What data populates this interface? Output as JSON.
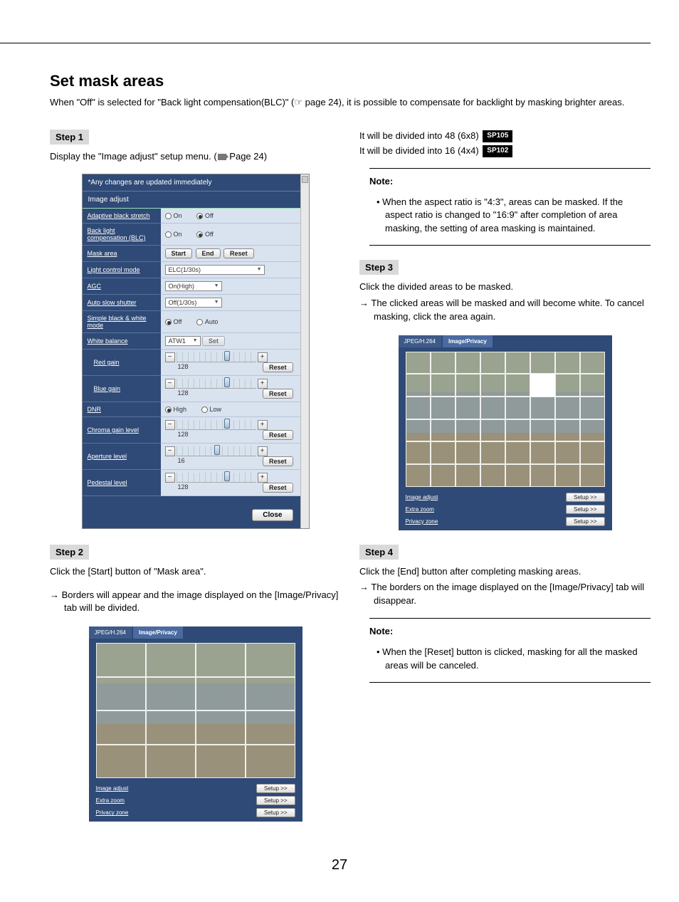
{
  "page_number": "27",
  "title": "Set mask areas",
  "intro": "When \"Off\" is selected for \"Back light compensation(BLC)\" (☞ page 24), it is possible to compensate for backlight by masking brighter areas.",
  "step1": {
    "tag": "Step 1",
    "text": "Display the \"Image adjust\" setup menu. (",
    "ref": " Page 24)"
  },
  "step2": {
    "tag": "Step 2",
    "lead": "Click the [Start] button of \"Mask area\".",
    "arrow": "Borders will appear and the image displayed on the [Image/Privacy] tab will be divided."
  },
  "divided_48": "It will be divided into 48 (6x8)",
  "divided_16": "It will be divided into 16 (4x4)",
  "badge_sp105": "SP105",
  "badge_sp102": "SP102",
  "note1_title": "Note:",
  "note1_body": "When the aspect ratio is \"4:3\", areas can be masked. If the aspect ratio is changed to \"16:9\" after completion of area masking, the setting of area masking is maintained.",
  "step3": {
    "tag": "Step 3",
    "lead": "Click the divided areas to be masked.",
    "arrow": "The clicked areas will be masked and will become white. To cancel masking, click the area again."
  },
  "step4": {
    "tag": "Step 4",
    "lead": "Click the [End] button after completing masking areas.",
    "arrow": "The borders on the image displayed on the [Image/Privacy] tab will disappear."
  },
  "note2_title": "Note:",
  "note2_body": "When the [Reset] button is clicked, masking for all the masked areas will be canceled.",
  "ia": {
    "head": "*Any changes are updated immediately",
    "sub": "Image adjust",
    "rows": {
      "abs": "Adaptive black stretch",
      "blc": "Back light compensation (BLC)",
      "mask": "Mask area",
      "lcm": "Light control mode",
      "agc": "AGC",
      "ass": "Auto slow shutter",
      "sbw": "Simple black & white mode",
      "wb": "White balance",
      "rg": "Red gain",
      "bg": "Blue gain",
      "dnr": "DNR",
      "cgl": "Chroma gain level",
      "apl": "Aperture level",
      "pdl": "Pedestal level"
    },
    "opt_on": "On",
    "opt_off": "Off",
    "opt_auto": "Auto",
    "opt_high": "High",
    "opt_low": "Low",
    "btn_start": "Start",
    "btn_end": "End",
    "btn_reset": "Reset",
    "btn_set": "Set",
    "btn_close": "Close",
    "sel_lcm": "ELC(1/30s)",
    "sel_agc": "On(High)",
    "sel_ass": "Off(1/30s)",
    "sel_wb": "ATW1",
    "val_rg": "128",
    "val_bg": "128",
    "val_cgl": "128",
    "val_apl": "16",
    "val_pdl": "128",
    "reset": "Reset"
  },
  "priv": {
    "tab1": "JPEG/H.264",
    "tab2": "Image/Privacy",
    "rows": {
      "ia": "Image adjust",
      "ez": "Extra zoom",
      "pz": "Privacy zone"
    },
    "setup": "Setup >>"
  }
}
